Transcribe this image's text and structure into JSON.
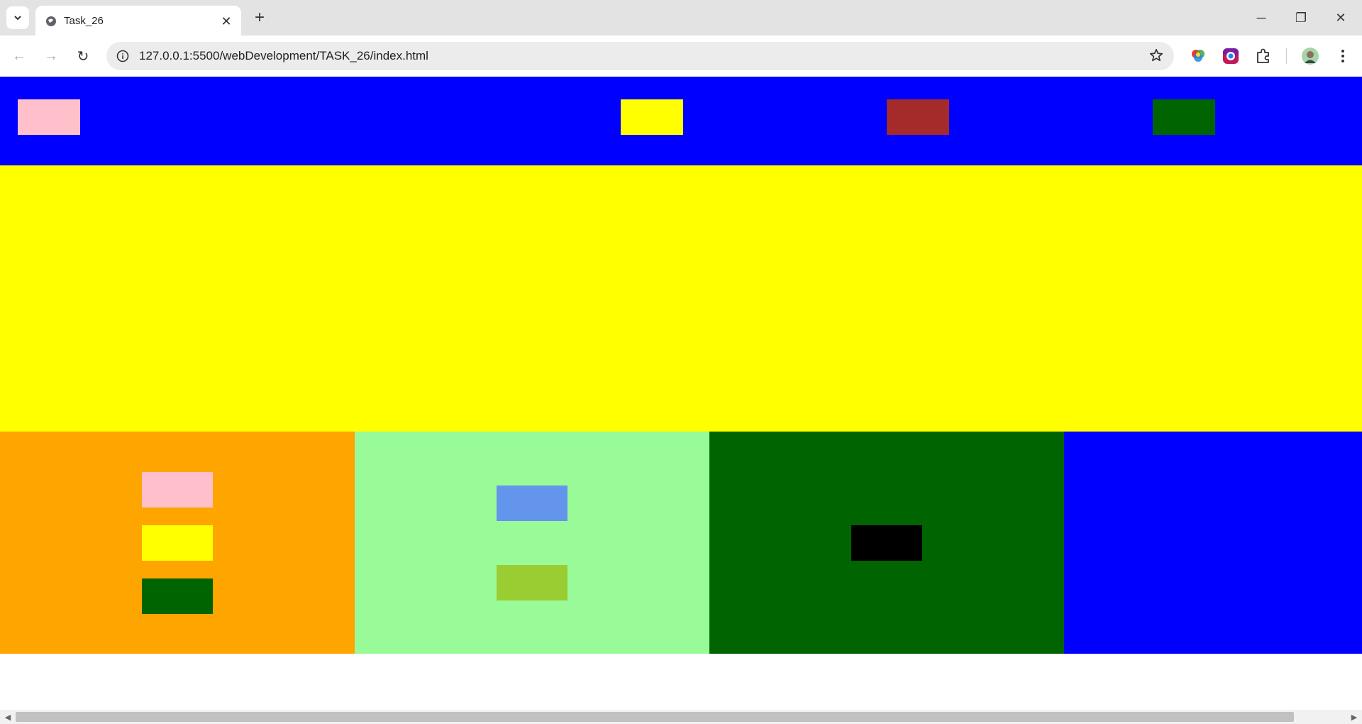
{
  "browser": {
    "tab_title": "Task_26",
    "url": "127.0.0.1:5500/webDevelopment/TASK_26/index.html",
    "tab_close_glyph": "✕",
    "new_tab_glyph": "+",
    "minimize_glyph": "─",
    "restore_glyph": "❐",
    "close_glyph": "✕",
    "back_glyph": "←",
    "forward_glyph": "→",
    "reload_glyph": "↻"
  },
  "colors": {
    "header_bg": "#0000ff",
    "hero_bg": "#ffff00",
    "col1_bg": "#ffa500",
    "col2_bg": "#98fb98",
    "col3_bg": "#006400",
    "col4_bg": "#0000ff",
    "header_boxes": [
      "#ffc0cb",
      "#ffff00",
      "#a52a2a",
      "#006400"
    ],
    "col1_boxes": [
      "#ffc0cb",
      "#ffff00",
      "#006400"
    ],
    "col2_boxes": [
      "#6495ed",
      "#9acd32"
    ],
    "col3_boxes": [
      "#000000"
    ]
  },
  "icons": {
    "tab_list": "chevron-down-icon",
    "favicon": "globe-icon",
    "info": "info-icon",
    "bookmark": "star-icon",
    "extensions": [
      "color-picker-extension-icon",
      "screen-recorder-extension-icon",
      "puzzle-extensions-icon"
    ],
    "profile": "avatar-icon",
    "menu": "kebab-menu-icon"
  }
}
